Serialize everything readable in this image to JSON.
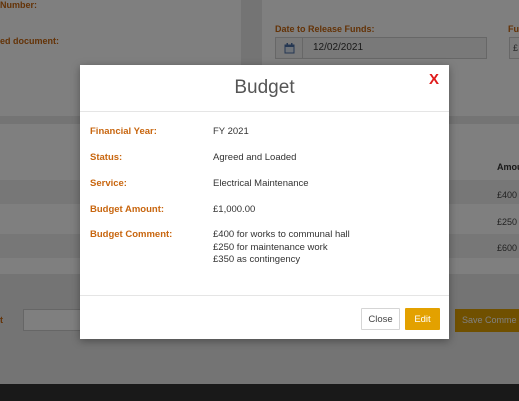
{
  "background": {
    "left_label_1": "Number:",
    "left_label_2": "ed document:",
    "date_label": "Date to Release Funds:",
    "date_value": "12/02/2021",
    "fu_label": "Fu",
    "fu_value": "£",
    "amount_header": "Amou",
    "amounts": [
      "£400",
      "£250",
      "£600"
    ],
    "comment_label": "t",
    "save_button": "Save Comme"
  },
  "modal": {
    "title": "Budget",
    "close_icon": "X",
    "fields": [
      {
        "label": "Financial Year:",
        "value": "FY 2021"
      },
      {
        "label": "Status:",
        "value": "Agreed and Loaded"
      },
      {
        "label": "Service:",
        "value": "Electrical Maintenance"
      },
      {
        "label": "Budget Amount:",
        "value": "£1,000.00"
      }
    ],
    "comment": {
      "label": "Budget Comment:",
      "lines": [
        "£400 for works to communal hall",
        "£250 for maintenance work",
        "£350 as contingency"
      ]
    },
    "close_button": "Close",
    "edit_button": "Edit"
  },
  "colors": {
    "label_orange": "#c8660f",
    "button_amber": "#e3a100",
    "close_red": "#e01b1b"
  },
  "icons": [
    "calendar-icon",
    "close-icon"
  ]
}
